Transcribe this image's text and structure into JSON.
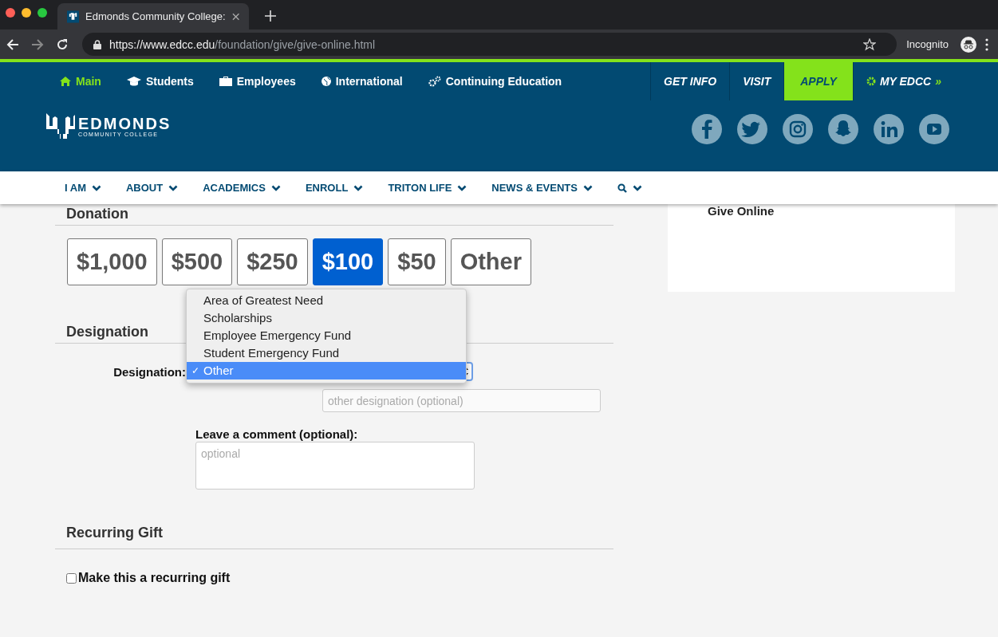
{
  "browser": {
    "tab_title": "Edmonds Community College:",
    "url_host": "https://www.edcc.edu",
    "url_path": "/foundation/give/give-online.html",
    "profile": "Incognito"
  },
  "top_nav": {
    "items": [
      {
        "label": "Main",
        "selected": true
      },
      {
        "label": "Students",
        "selected": false
      },
      {
        "label": "Employees",
        "selected": false
      },
      {
        "label": "International",
        "selected": false
      },
      {
        "label": "Continuing Education",
        "selected": false
      }
    ],
    "actions": [
      {
        "label": "GET INFO",
        "kind": "plain"
      },
      {
        "label": "VISIT",
        "kind": "plain"
      },
      {
        "label": "APPLY",
        "kind": "highlight"
      },
      {
        "label": "MY EDCC",
        "kind": "account"
      }
    ],
    "account_suffix": "»"
  },
  "logo": {
    "name": "EDMONDS",
    "subtitle": "COMMUNITY COLLEGE"
  },
  "main_nav": [
    "I AM",
    "ABOUT",
    "ACADEMICS",
    "ENROLL",
    "TRITON LIFE",
    "NEWS & EVENTS"
  ],
  "donation": {
    "heading": "Donation",
    "amounts": [
      {
        "label": "$1,000",
        "selected": false
      },
      {
        "label": "$500",
        "selected": false
      },
      {
        "label": "$250",
        "selected": false
      },
      {
        "label": "$100",
        "selected": true
      },
      {
        "label": "$50",
        "selected": false
      },
      {
        "label": "Other",
        "selected": false
      }
    ]
  },
  "designation": {
    "heading": "Designation",
    "label": "Designation:",
    "options": [
      {
        "label": "Area of Greatest Need",
        "selected": false
      },
      {
        "label": "Scholarships",
        "selected": false
      },
      {
        "label": "Employee Emergency Fund",
        "selected": false
      },
      {
        "label": "Student Emergency Fund",
        "selected": false
      },
      {
        "label": "Other",
        "selected": true
      }
    ],
    "check_mark": "✓",
    "other_placeholder": "other designation (optional)",
    "comment_label": "Leave a comment (optional):",
    "comment_placeholder": "optional"
  },
  "recurring": {
    "heading": "Recurring Gift",
    "label": "Make this a recurring gift",
    "checked": false
  },
  "sidebar": {
    "items": [
      "Give Online"
    ]
  }
}
